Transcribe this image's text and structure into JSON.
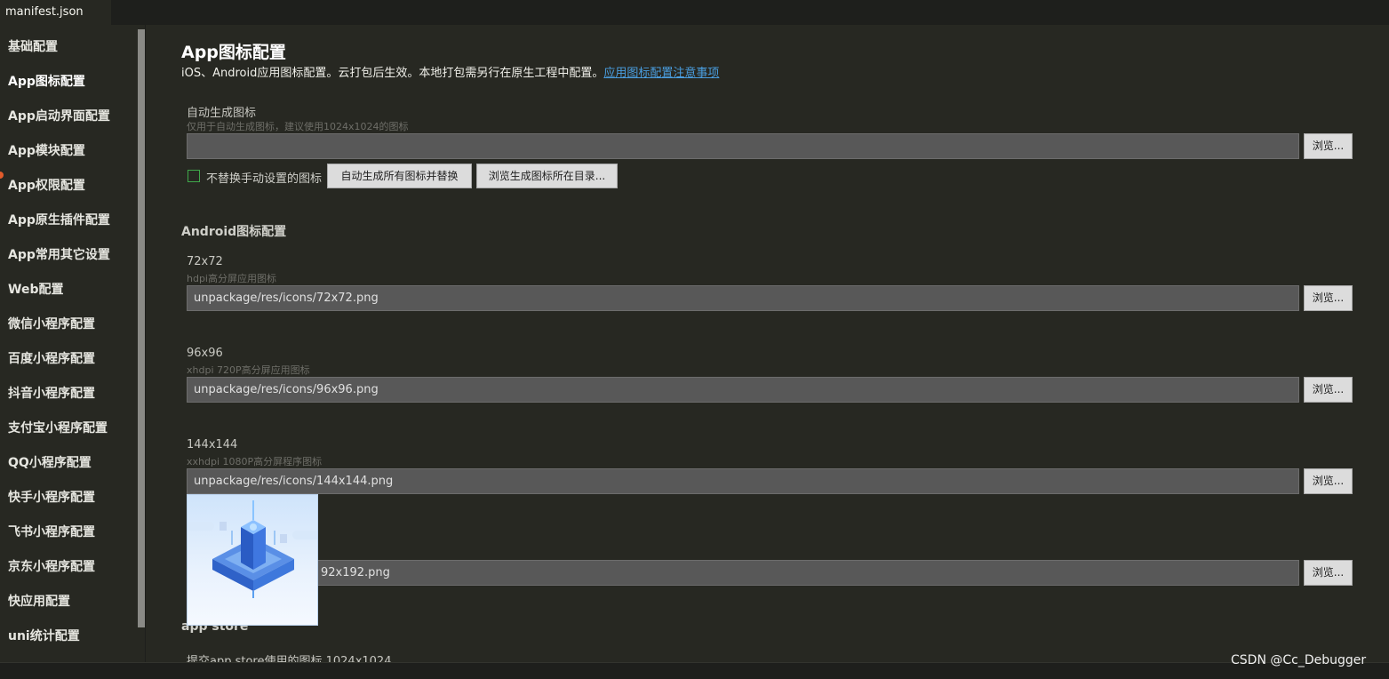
{
  "tab": {
    "title": "manifest.json"
  },
  "sidebar": {
    "items": [
      "基础配置",
      "App图标配置",
      "App启动界面配置",
      "App模块配置",
      "App权限配置",
      "App原生插件配置",
      "App常用其它设置",
      "Web配置",
      "微信小程序配置",
      "百度小程序配置",
      "抖音小程序配置",
      "支付宝小程序配置",
      "QQ小程序配置",
      "快手小程序配置",
      "飞书小程序配置",
      "京东小程序配置",
      "快应用配置",
      "uni统计配置"
    ]
  },
  "page": {
    "title": "App图标配置",
    "desc": "iOS、Android应用图标配置。云打包后生效。本地打包需另行在原生工程中配置。",
    "desc_link": "应用图标配置注意事项"
  },
  "auto_gen": {
    "label": "自动生成图标",
    "hint": "仅用于自动生成图标，建议使用1024x1024的图标",
    "value": "",
    "browse": "浏览...",
    "checkbox_label": "不替换手动设置的图标",
    "btn_generate": "自动生成所有图标并替换",
    "btn_browse_dir": "浏览生成图标所在目录..."
  },
  "android": {
    "section_title": "Android图标配置",
    "fields": [
      {
        "label": "72x72",
        "hint": "hdpi高分屏应用图标",
        "value": "unpackage/res/icons/72x72.png",
        "browse": "浏览..."
      },
      {
        "label": "96x96",
        "hint": "xhdpi 720P高分屏应用图标",
        "value": "unpackage/res/icons/96x96.png",
        "browse": "浏览..."
      },
      {
        "label": "144x144",
        "hint": "xxhdpi 1080P高分屏程序图标",
        "value": "unpackage/res/icons/144x144.png",
        "browse": "浏览..."
      },
      {
        "label": "",
        "hint": "",
        "value": "92x192.png",
        "browse": "浏览..."
      }
    ]
  },
  "appstore": {
    "section_title": "app store",
    "label": "提交app store使用的图标 1024x1024"
  },
  "watermark": "CSDN @Cc_Debugger",
  "colors": {
    "accent_link": "#4a9ee0",
    "active_dot": "#e25b2b",
    "checkbox_border": "#3fa84a"
  }
}
